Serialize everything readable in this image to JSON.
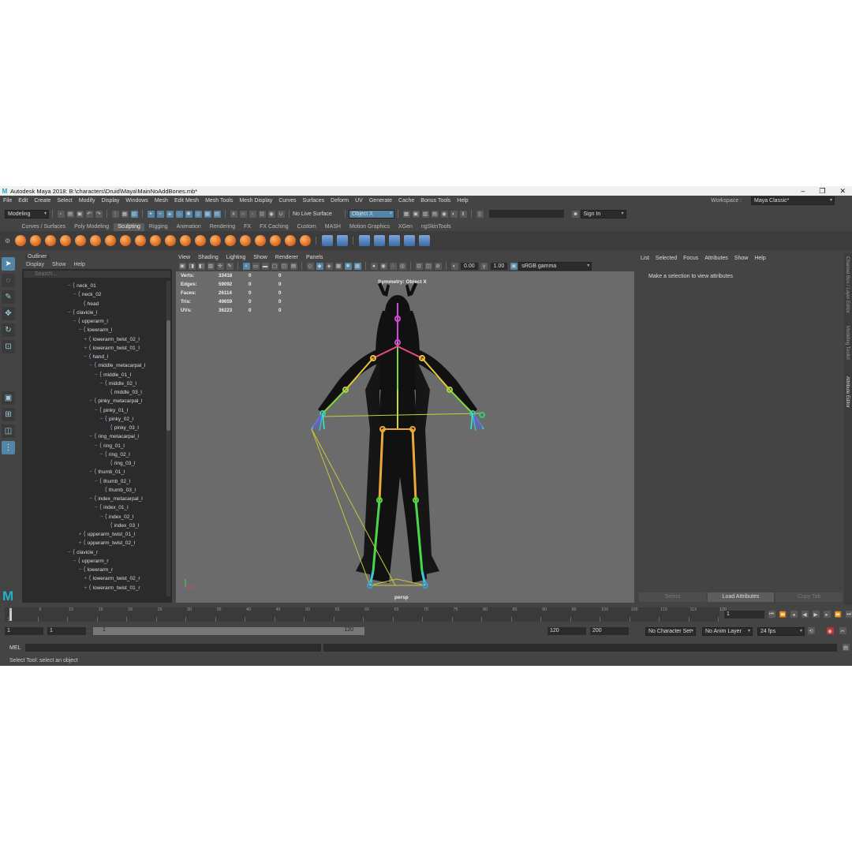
{
  "window": {
    "title": "Autodesk Maya 2018: B:\\characters\\Druid\\Maya\\MainNoAddBones.mb*",
    "controls": [
      "–",
      "❐",
      "✕"
    ]
  },
  "menubar": {
    "items": [
      "File",
      "Edit",
      "Create",
      "Select",
      "Modify",
      "Display",
      "Windows",
      "Mesh",
      "Edit Mesh",
      "Mesh Tools",
      "Mesh Display",
      "Curves",
      "Surfaces",
      "Deform",
      "UV",
      "Generate",
      "Cache",
      "Bonus Tools",
      "Help"
    ],
    "workspace_label": "Workspace :",
    "workspace_value": "Maya Classic*"
  },
  "statusline": {
    "menuset": "Modeling",
    "live_surface": "No Live Surface",
    "symmetry": "Object X",
    "sign_in": "Sign In"
  },
  "shelf": {
    "tabs": [
      "Curves / Surfaces",
      "Poly Modeling",
      "Sculpting",
      "Rigging",
      "Animation",
      "Rendering",
      "FX",
      "FX Caching",
      "Custom",
      "MASH",
      "Motion Graphics",
      "XGen",
      "ngSkinTools"
    ],
    "active_tab": "Sculpting"
  },
  "outliner": {
    "title": "Outliner",
    "menu": [
      "Display",
      "Show",
      "Help"
    ],
    "search_placeholder": "Search...",
    "rows": [
      {
        "label": "neck_01",
        "depth": 0,
        "expander": "−"
      },
      {
        "label": "neck_02",
        "depth": 1,
        "expander": "−"
      },
      {
        "label": "head",
        "depth": 2,
        "expander": ""
      },
      {
        "label": "clavicle_l",
        "depth": 0,
        "expander": "−"
      },
      {
        "label": "upperarm_l",
        "depth": 1,
        "expander": "−"
      },
      {
        "label": "lowerarm_l",
        "depth": 2,
        "expander": "−"
      },
      {
        "label": "lowerarm_twist_02_l",
        "depth": 3,
        "expander": "+"
      },
      {
        "label": "lowerarm_twist_01_l",
        "depth": 3,
        "expander": "+"
      },
      {
        "label": "hand_l",
        "depth": 3,
        "expander": "−"
      },
      {
        "label": "middle_metacarpal_l",
        "depth": 4,
        "expander": "−"
      },
      {
        "label": "middle_01_l",
        "depth": 5,
        "expander": "−"
      },
      {
        "label": "middle_02_l",
        "depth": 6,
        "expander": "−"
      },
      {
        "label": "middle_03_l",
        "depth": 7,
        "expander": ""
      },
      {
        "label": "pinky_metacarpal_l",
        "depth": 4,
        "expander": "−"
      },
      {
        "label": "pinky_01_l",
        "depth": 5,
        "expander": "−"
      },
      {
        "label": "pinky_02_l",
        "depth": 6,
        "expander": "−"
      },
      {
        "label": "pinky_03_l",
        "depth": 7,
        "expander": ""
      },
      {
        "label": "ring_metacarpal_l",
        "depth": 4,
        "expander": "−"
      },
      {
        "label": "ring_01_l",
        "depth": 5,
        "expander": "−"
      },
      {
        "label": "ring_02_l",
        "depth": 6,
        "expander": "−"
      },
      {
        "label": "ring_03_l",
        "depth": 7,
        "expander": ""
      },
      {
        "label": "thumb_01_l",
        "depth": 4,
        "expander": "−"
      },
      {
        "label": "thumb_02_l",
        "depth": 5,
        "expander": "−"
      },
      {
        "label": "thumb_03_l",
        "depth": 6,
        "expander": ""
      },
      {
        "label": "index_metacarpal_l",
        "depth": 4,
        "expander": "−"
      },
      {
        "label": "index_01_l",
        "depth": 5,
        "expander": "−"
      },
      {
        "label": "index_02_l",
        "depth": 6,
        "expander": "−"
      },
      {
        "label": "index_03_l",
        "depth": 7,
        "expander": ""
      },
      {
        "label": "upperarm_twist_01_l",
        "depth": 2,
        "expander": "+"
      },
      {
        "label": "upperarm_twist_02_l",
        "depth": 2,
        "expander": "+"
      },
      {
        "label": "clavicle_r",
        "depth": 0,
        "expander": "−"
      },
      {
        "label": "upperarm_r",
        "depth": 1,
        "expander": "−"
      },
      {
        "label": "lowerarm_r",
        "depth": 2,
        "expander": "−"
      },
      {
        "label": "lowerarm_twist_02_r",
        "depth": 3,
        "expander": "+"
      },
      {
        "label": "lowerarm_twist_01_r",
        "depth": 3,
        "expander": "+"
      }
    ]
  },
  "viewport": {
    "menu": [
      "View",
      "Shading",
      "Lighting",
      "Show",
      "Renderer",
      "Panels"
    ],
    "exposure": "0.00",
    "gamma": "1.00",
    "color_space": "sRGB gamma",
    "hud": [
      {
        "label": "Verts:",
        "v1": "33418",
        "v2": "0",
        "v3": "0"
      },
      {
        "label": "Edges:",
        "v1": "59092",
        "v2": "0",
        "v3": "0"
      },
      {
        "label": "Faces:",
        "v1": "26114",
        "v2": "0",
        "v3": "0"
      },
      {
        "label": "Tris:",
        "v1": "49659",
        "v2": "0",
        "v3": "0"
      },
      {
        "label": "UVs:",
        "v1": "36223",
        "v2": "0",
        "v3": "0"
      }
    ],
    "symmetry_label": "Symmetry: Object X",
    "camera": "persp"
  },
  "attribute_editor": {
    "menu": [
      "List",
      "Selected",
      "Focus",
      "Attributes",
      "Show",
      "Help"
    ],
    "message": "Make a selection to view attributes",
    "buttons": [
      "Select",
      "Load Attributes",
      "Copy Tab"
    ]
  },
  "side_tabs": [
    "Channel Box / Layer Editor",
    "Modeling Toolkit",
    "Attribute Editor"
  ],
  "timeline": {
    "ticks": [
      "1",
      "5",
      "10",
      "15",
      "20",
      "25",
      "30",
      "35",
      "40",
      "45",
      "50",
      "55",
      "60",
      "65",
      "70",
      "75",
      "80",
      "85",
      "90",
      "95",
      "100",
      "105",
      "110",
      "115",
      "120"
    ],
    "current_frame": "1"
  },
  "range": {
    "start": "1",
    "playback_start": "1",
    "slider_start": "1",
    "slider_end": "120",
    "playback_end": "120",
    "end": "200",
    "character_set": "No Character Set",
    "anim_layer": "No Anim Layer",
    "fps": "24 fps"
  },
  "command_line": {
    "lang": "MEL"
  },
  "help_line": "Select Tool: select an object"
}
